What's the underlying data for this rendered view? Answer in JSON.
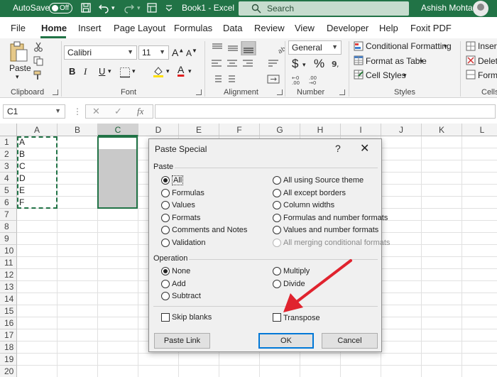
{
  "colors": {
    "excel_green": "#217346",
    "arrow_red": "#e0232e",
    "default_button_blue": "#0078d7"
  },
  "titlebar": {
    "autosave_label": "AutoSave",
    "autosave_state": "Off",
    "doc_title": "Book1 - Excel",
    "search_placeholder": "Search",
    "user_name": "Ashish Mohta",
    "icons": [
      "save-icon",
      "undo-icon",
      "redo-icon",
      "touch-mode-icon",
      "customize-qat-icon",
      "search-icon"
    ]
  },
  "tabs": [
    "File",
    "Home",
    "Insert",
    "Page Layout",
    "Formulas",
    "Data",
    "Review",
    "View",
    "Developer",
    "Help",
    "Foxit PDF"
  ],
  "active_tab": "Home",
  "ribbon": {
    "clipboard": {
      "label": "Clipboard",
      "paste": "Paste"
    },
    "font": {
      "label": "Font",
      "font_name": "Calibri",
      "font_size": "11",
      "bold": "B",
      "italic": "I",
      "underline": "U"
    },
    "alignment": {
      "label": "Alignment"
    },
    "number": {
      "label": "Number",
      "format": "General",
      "currency": "$",
      "percent": "%"
    },
    "styles": {
      "label": "Styles",
      "conditional_formatting": "Conditional Formatting",
      "format_as_table": "Format as Table",
      "cell_styles": "Cell Styles"
    },
    "cells": {
      "label": "Cells",
      "insert": "Insert",
      "delete": "Delete",
      "format": "Format"
    }
  },
  "formula_bar": {
    "name_box": "C1",
    "fx": "fx",
    "value": ""
  },
  "grid": {
    "columns": [
      "A",
      "B",
      "C",
      "D",
      "E",
      "F",
      "G",
      "H",
      "I",
      "J",
      "K",
      "L"
    ],
    "rows": [
      "1",
      "2",
      "3",
      "4",
      "5",
      "6",
      "7",
      "8",
      "9",
      "10",
      "11",
      "12",
      "13",
      "14",
      "15",
      "16",
      "17",
      "18",
      "19",
      "20"
    ],
    "column_a_values": [
      "A",
      "B",
      "C",
      "D",
      "E",
      "F"
    ],
    "selected_column": "C"
  },
  "dialog": {
    "title": "Paste Special",
    "help": "?",
    "close": "✕",
    "paste_section": "Paste",
    "paste_left": [
      "All",
      "Formulas",
      "Values",
      "Formats",
      "Comments and Notes",
      "Validation"
    ],
    "paste_right": [
      "All using Source theme",
      "All except borders",
      "Column widths",
      "Formulas and number formats",
      "Values and number formats",
      "All merging conditional formats"
    ],
    "paste_selected": "All",
    "operation_section": "Operation",
    "operation_left": [
      "None",
      "Add",
      "Subtract"
    ],
    "operation_right": [
      "Multiply",
      "Divide"
    ],
    "operation_selected": "None",
    "skip_blanks": "Skip blanks",
    "transpose": "Transpose",
    "paste_link": "Paste Link",
    "ok": "OK",
    "cancel": "Cancel"
  }
}
